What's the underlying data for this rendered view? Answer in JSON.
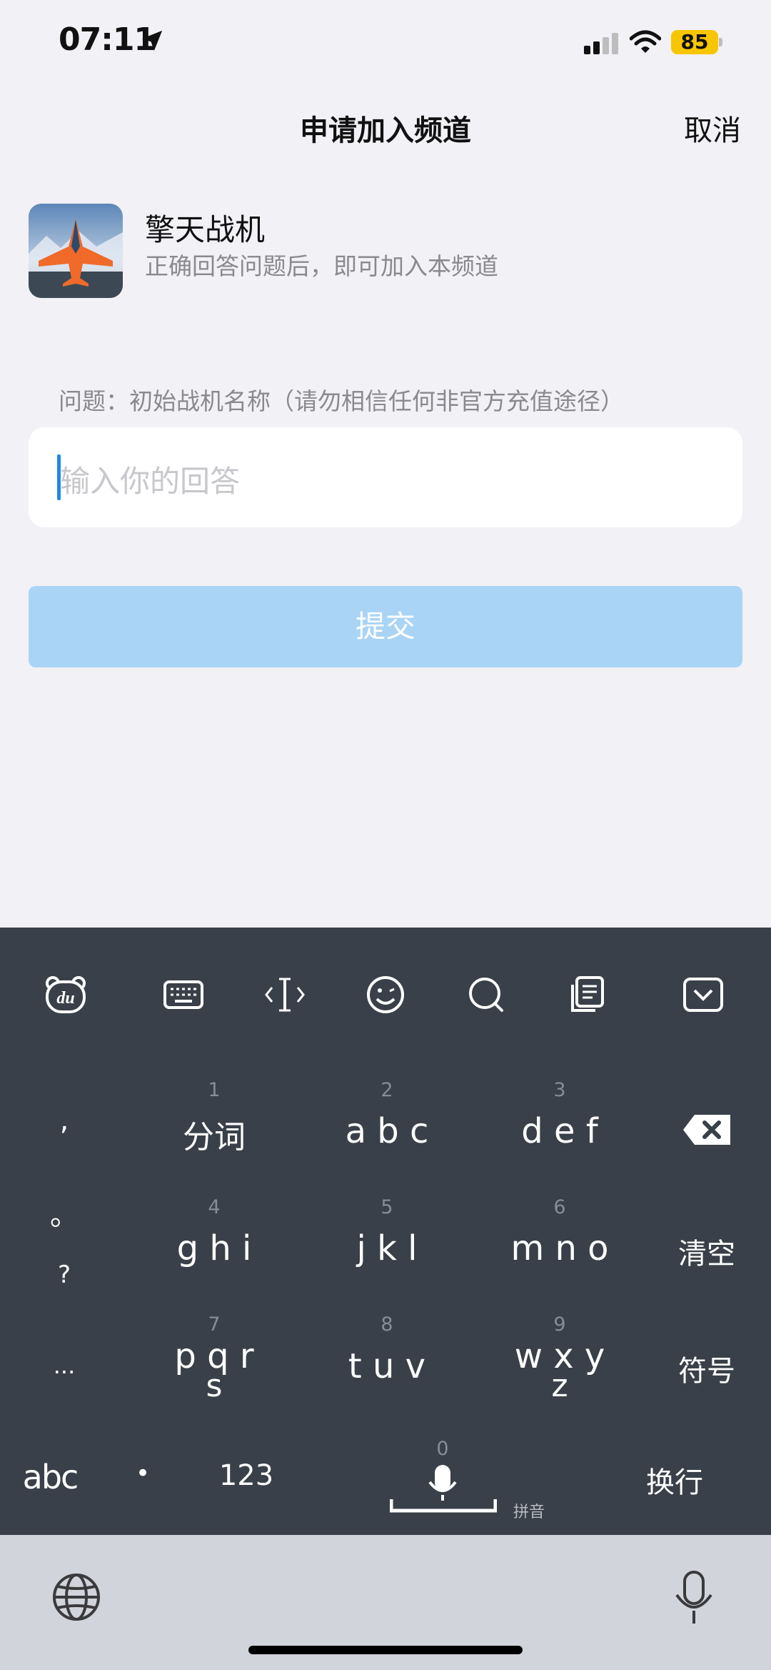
{
  "status": {
    "time": "07:11",
    "battery": "85"
  },
  "nav": {
    "title": "申请加入频道",
    "cancel": "取消"
  },
  "channel": {
    "name": "擎天战机",
    "subtitle": "正确回答问题后，即可加入本频道"
  },
  "question": "问题：初始战机名称（请勿相信任何非官方充值途径）",
  "input": {
    "placeholder": "输入你的回答"
  },
  "submit": "提交",
  "keyboard": {
    "toolbar": [
      "du-bear-icon",
      "keyboard-icon",
      "cursor-icon",
      "emoji-icon",
      "search-icon",
      "clipboard-icon",
      "collapse-icon"
    ],
    "left_col": [
      ",",
      "。",
      "?",
      "..."
    ],
    "keys": [
      {
        "num": "1",
        "label": "分词"
      },
      {
        "num": "2",
        "label": "a b c"
      },
      {
        "num": "3",
        "label": "d e f"
      },
      {
        "num": "4",
        "label": "g h i"
      },
      {
        "num": "5",
        "label": "j k l"
      },
      {
        "num": "6",
        "label": "m n o"
      },
      {
        "num": "7",
        "label": "p q r",
        "label2": "s"
      },
      {
        "num": "8",
        "label": "t u v"
      },
      {
        "num": "9",
        "label": "w x y",
        "label2": "z"
      }
    ],
    "right_col": {
      "delete": "delete-icon",
      "clear": "清空",
      "symbol": "符号"
    },
    "bottom_row": {
      "abc": "abc",
      "dot": "•",
      "num123": "123",
      "space_num": "0",
      "pinyin": "拼音",
      "enter": "换行"
    }
  }
}
